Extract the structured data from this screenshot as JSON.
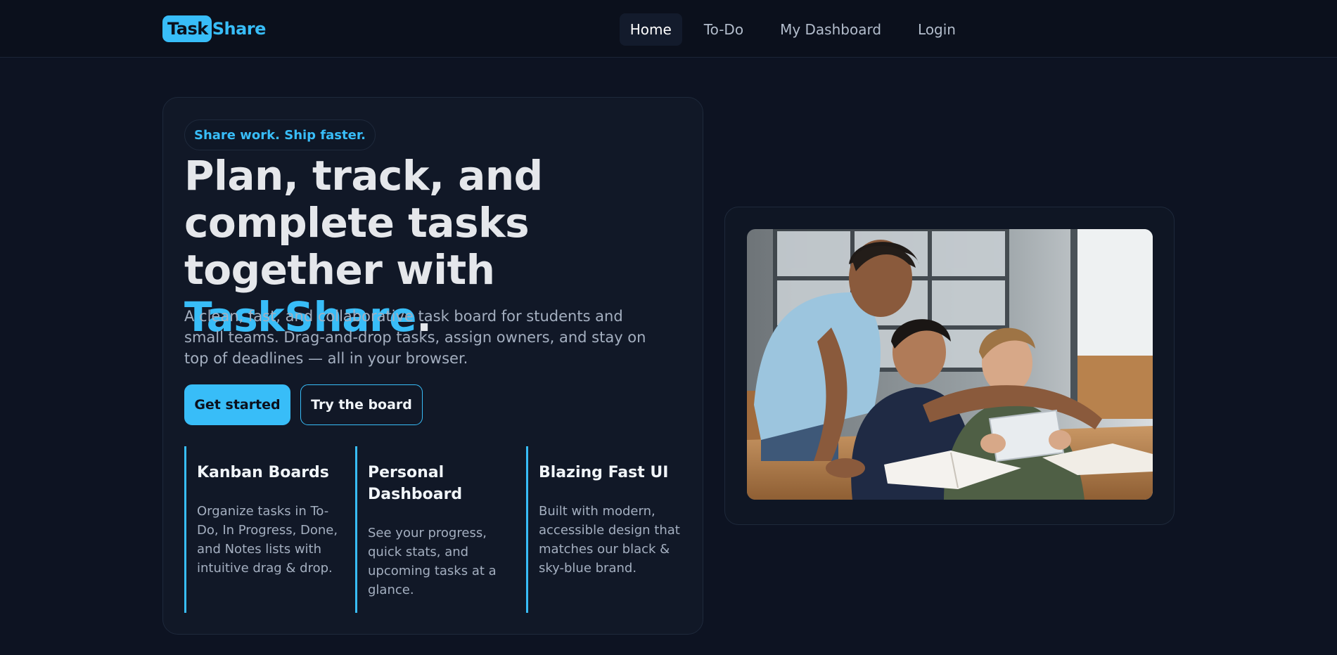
{
  "nav": {
    "logo_badge": "Task",
    "logo_text": "Share",
    "links": [
      "Home",
      "To-Do",
      "My Dashboard",
      "Login"
    ]
  },
  "hero": {
    "tagline": "Share work. Ship faster.",
    "headline_part1": "Plan, track, and complete tasks together with ",
    "headline_brand": "TaskShare",
    "headline_end": ".",
    "lead": "A clean, fast, and collaborative task board for students and small teams. Drag-and-drop tasks, assign owners, and stay on top of deadlines — all in your browser.",
    "primary_cta": "Get started",
    "secondary_cta": "Try the board"
  },
  "features": [
    {
      "title": "Kanban Boards",
      "text": "Organize tasks in To-Do, In Progress, Done, and Notes lists with intuitive drag & drop."
    },
    {
      "title": "Personal Dashboard",
      "text": "See your progress, quick stats, and upcoming tasks at a glance."
    },
    {
      "title": "Blazing Fast UI",
      "text": "Built with modern, accessible design that matches our black & sky-blue brand."
    }
  ],
  "colors": {
    "background": "#0d1322",
    "accent": "#38bdf8",
    "card": "#111827",
    "muted_text": "#a4afc0"
  }
}
